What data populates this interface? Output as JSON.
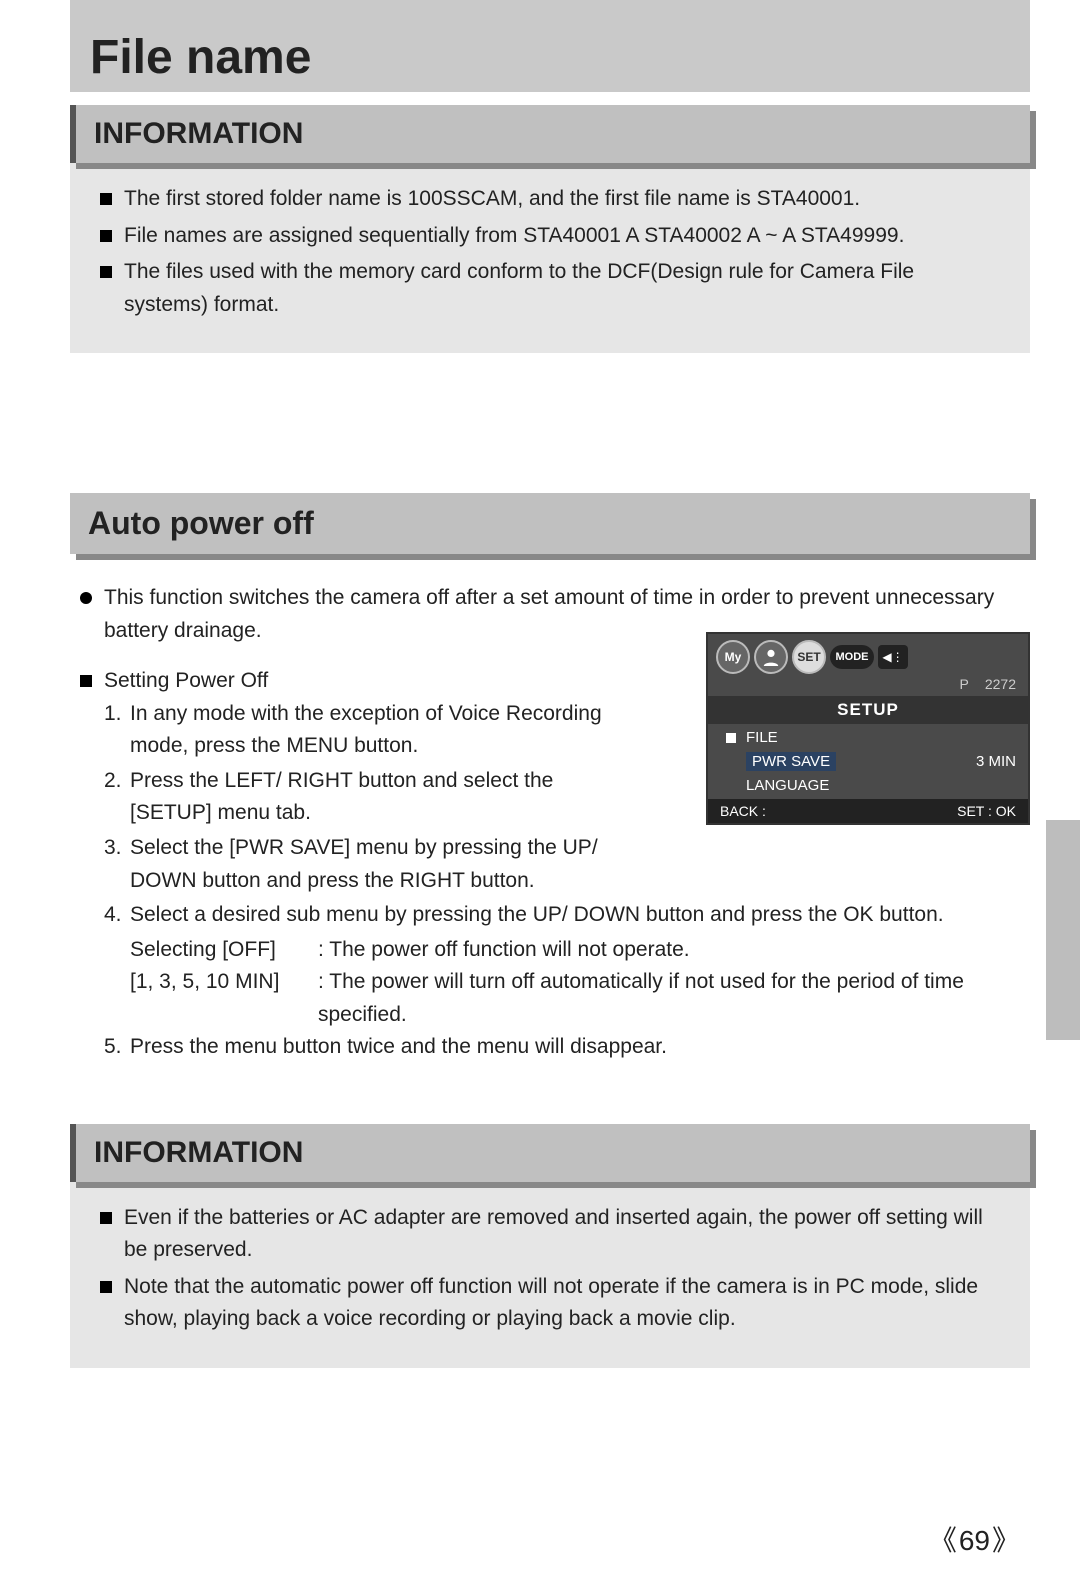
{
  "page": {
    "title": "File name",
    "number": "69"
  },
  "info1": {
    "heading": "INFORMATION",
    "items": [
      "The first stored folder name is 100SSCAM, and the first file name is STA40001.",
      "File names are assigned sequentially from STA40001  A STA40002  A ~  A STA49999.",
      "The files used with the memory card conform to the DCF(Design rule for Camera File systems) format."
    ]
  },
  "auto": {
    "heading": "Auto power off",
    "intro": "This function switches the camera off after a set amount of time in order to prevent unnecessary battery drainage.",
    "sub_heading": "Setting Power Off",
    "steps": [
      "In any mode with the exception of Voice Recording mode, press the MENU button.",
      "Press the LEFT/ RIGHT button and select the [SETUP] menu tab.",
      "Select the [PWR SAVE] menu by pressing the UP/ DOWN button and press the RIGHT button.",
      "Select a desired sub menu by pressing the UP/ DOWN button and press the OK button."
    ],
    "options": [
      {
        "label": "Selecting [OFF]",
        "desc": ": The power off function will not operate."
      },
      {
        "label": "[1, 3, 5, 10 MIN]",
        "desc": ": The power will turn off automatically if not used for the period of time",
        "cont": "specified."
      }
    ],
    "step5": "Press the menu button twice and the menu will disappear."
  },
  "screen": {
    "icons": {
      "my": "My",
      "set": "SET",
      "mode": "MODE"
    },
    "p": "P",
    "res": "2272",
    "title": "SETUP",
    "items": [
      {
        "label": "FILE",
        "val": ""
      },
      {
        "label": "PWR SAVE",
        "val": "3 MIN"
      },
      {
        "label": "LANGUAGE",
        "val": ""
      }
    ],
    "back": "BACK :",
    "set": "SET : OK"
  },
  "info2": {
    "heading": "INFORMATION",
    "items": [
      "Even if the batteries or AC adapter are removed and inserted again, the power off setting will be preserved.",
      "Note that the automatic power off function will not operate if the camera is in PC mode, slide show, playing back a voice recording or playing back a movie clip."
    ]
  }
}
